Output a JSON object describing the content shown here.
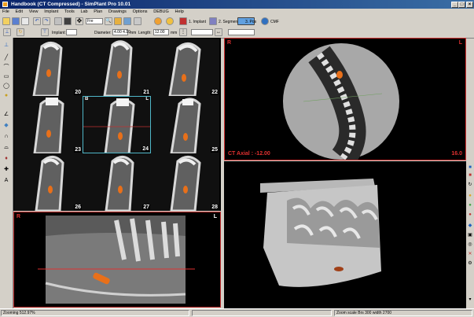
{
  "window": {
    "title": "Handbook (CT Compressed) - SimPlant Pro 10.01",
    "min_symbol": "_",
    "max_symbol": "□",
    "close_symbol": "×"
  },
  "menu": [
    "File",
    "Edit",
    "View",
    "Implant",
    "Tools",
    "Lab",
    "Plan",
    "Drawings",
    "Options",
    "DEBUG",
    "Help"
  ],
  "toolbar": {
    "zoom_value": "Fre",
    "implant_label": "1. Implant",
    "segment_label": "2. Segment",
    "pos_label": "3. Pos",
    "cmf_label": "CMF"
  },
  "toolbar2": {
    "implant_label": "Implant:",
    "implant_value": "",
    "diameter_label": "Diameter:",
    "diameter_value": "4.00  4.10",
    "diameter_unit": "mm",
    "length_label": "Length:",
    "length_value": "12.00",
    "length_unit": "mm"
  },
  "cross_sections": [
    {
      "num": "20"
    },
    {
      "num": "21"
    },
    {
      "num": "22"
    },
    {
      "num": "23"
    },
    {
      "num": "24"
    },
    {
      "num": "25"
    },
    {
      "num": "26"
    },
    {
      "num": "27"
    },
    {
      "num": "28"
    }
  ],
  "cross_section_selected_markers": {
    "left": "B",
    "right": "L"
  },
  "panoramic": {
    "left_marker": "R",
    "right_marker": "L"
  },
  "axial": {
    "left_marker": "R",
    "right_marker": "L",
    "caption": "CT Axial : -12.00",
    "value": "16.0"
  },
  "status": {
    "zoom": "Zooming 512.97%",
    "info": "Zoom scale  Brs 300 width 2700"
  },
  "colors": {
    "title_bar": "#0a246a",
    "selection_border": "#4fb7c8",
    "view_border": "#d03030",
    "implant": "#e8701a"
  }
}
